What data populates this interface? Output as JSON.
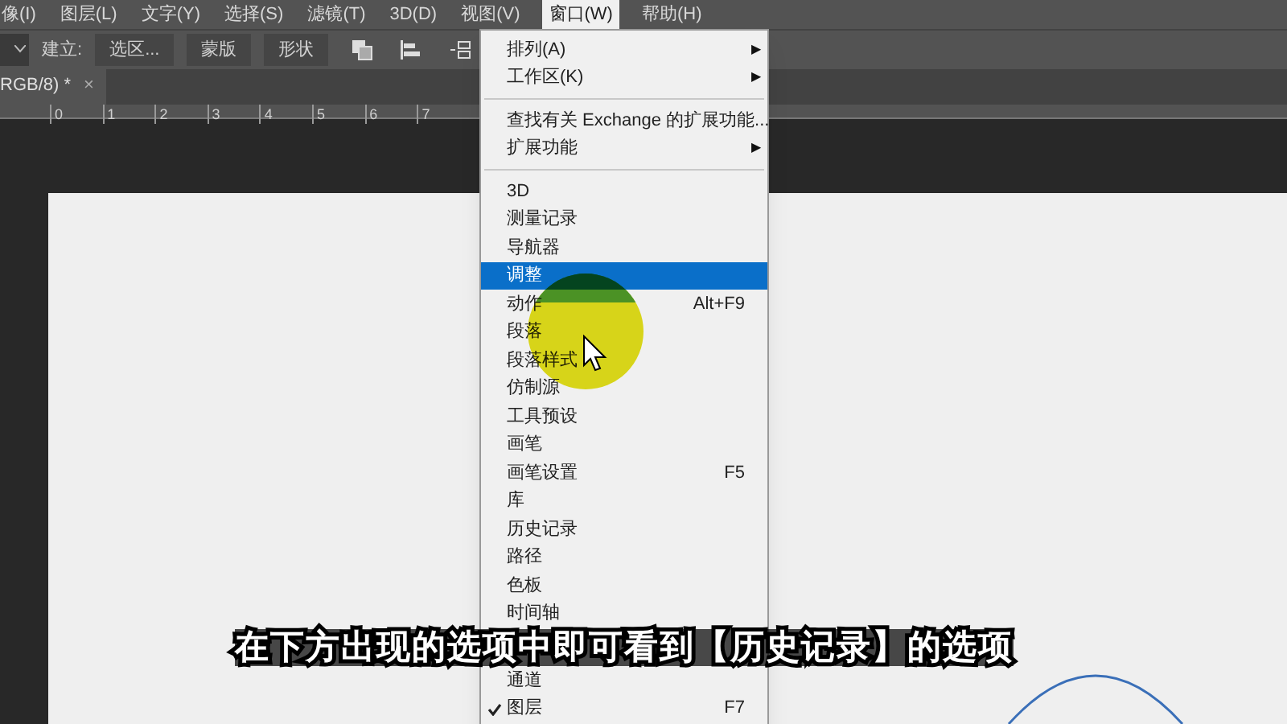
{
  "menu_bar": [
    {
      "label": "像(I)",
      "selected": false
    },
    {
      "label": "图层(L)",
      "selected": false
    },
    {
      "label": "文字(Y)",
      "selected": false
    },
    {
      "label": "选择(S)",
      "selected": false
    },
    {
      "label": "滤镜(T)",
      "selected": false
    },
    {
      "label": "3D(D)",
      "selected": false
    },
    {
      "label": "视图(V)",
      "selected": false
    },
    {
      "label": "窗口(W)",
      "selected": true
    },
    {
      "label": "帮助(H)",
      "selected": false
    }
  ],
  "options_bar": {
    "label": "建立:",
    "buttons": [
      "选区...",
      "蒙版",
      "形状"
    ]
  },
  "document_tab": {
    "title": "RGB/8) *",
    "close": "×"
  },
  "ruler": [
    "0",
    "1",
    "2",
    "3",
    "4",
    "5",
    "6",
    "7"
  ],
  "window_menu": [
    {
      "kind": "submenu",
      "label": "排列(A)",
      "arrow": "▶"
    },
    {
      "kind": "submenu",
      "label": "工作区(K)",
      "arrow": "▶"
    },
    {
      "kind": "separator"
    },
    {
      "kind": "item",
      "label": "查找有关 Exchange 的扩展功能...",
      "selected": false,
      "checked": false
    },
    {
      "kind": "submenu",
      "label": "扩展功能",
      "arrow": "▶"
    },
    {
      "kind": "separator"
    },
    {
      "kind": "item",
      "label": "3D",
      "selected": false,
      "checked": false
    },
    {
      "kind": "item",
      "label": "测量记录",
      "selected": false,
      "checked": false
    },
    {
      "kind": "item",
      "label": "导航器",
      "selected": false,
      "checked": false
    },
    {
      "kind": "item",
      "label": "调整",
      "selected": true,
      "checked": false
    },
    {
      "kind": "item",
      "label": "动作",
      "shortcut": "Alt+F9",
      "selected": false,
      "checked": false
    },
    {
      "kind": "item",
      "label": "段落",
      "selected": false,
      "checked": false
    },
    {
      "kind": "item",
      "label": "段落样式",
      "selected": false,
      "checked": false
    },
    {
      "kind": "item",
      "label": "仿制源",
      "selected": false,
      "checked": false
    },
    {
      "kind": "item",
      "label": "工具预设",
      "selected": false,
      "checked": false
    },
    {
      "kind": "item",
      "label": "画笔",
      "selected": false,
      "checked": false
    },
    {
      "kind": "item",
      "label": "画笔设置",
      "shortcut": "F5",
      "selected": false,
      "checked": false
    },
    {
      "kind": "item",
      "label": "库",
      "selected": false,
      "checked": false
    },
    {
      "kind": "item",
      "label": "历史记录",
      "selected": false,
      "checked": false
    },
    {
      "kind": "item",
      "label": "路径",
      "selected": false,
      "checked": false
    },
    {
      "kind": "item",
      "label": "色板",
      "selected": false,
      "checked": false
    },
    {
      "kind": "item",
      "label": "时间轴",
      "selected": false,
      "checked": false
    },
    {
      "kind": "covered"
    },
    {
      "kind": "item",
      "label": "通道",
      "selected": false,
      "checked": false
    },
    {
      "kind": "item",
      "label": "图层",
      "shortcut": "F7",
      "selected": false,
      "checked": true
    }
  ],
  "subtitle": "在下方出现的选项中即可看到【历史记录】的选项"
}
